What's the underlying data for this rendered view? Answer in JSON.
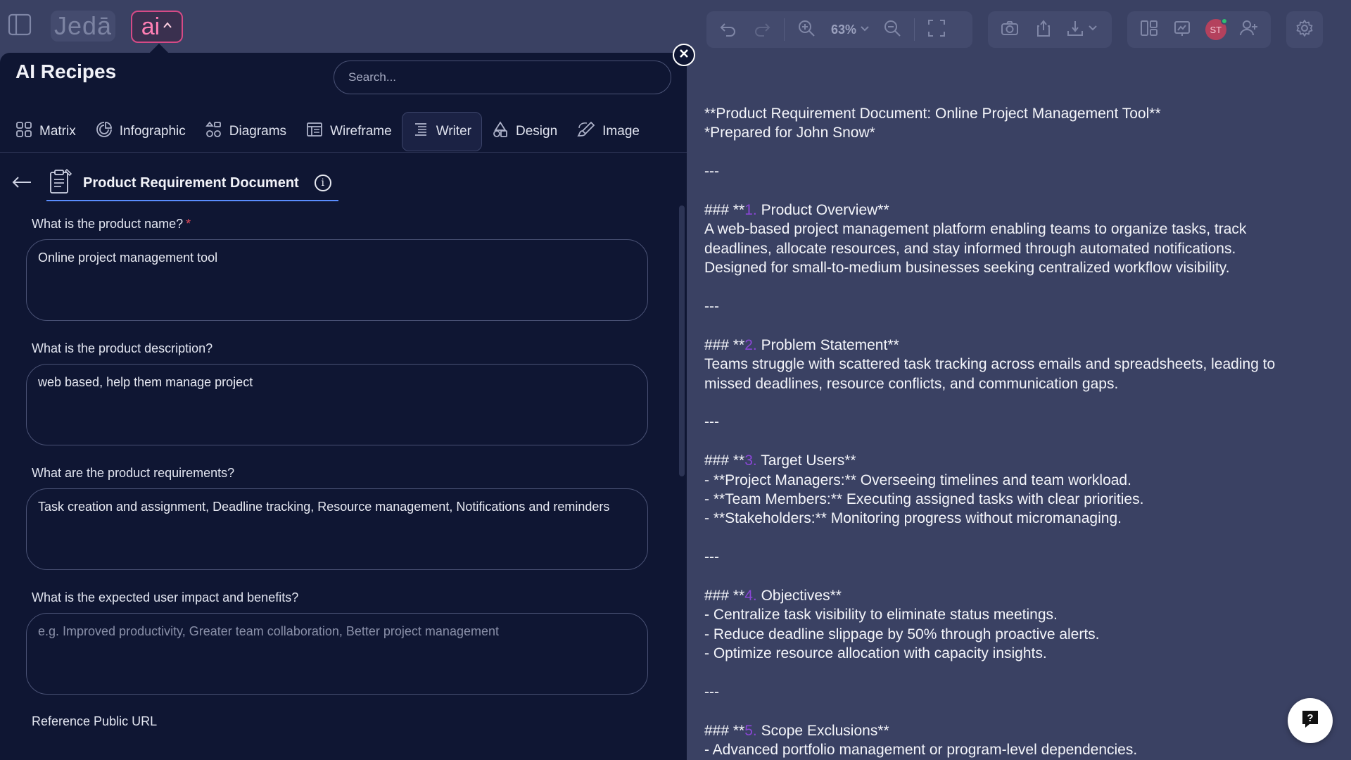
{
  "app": {
    "logo": "Jedā",
    "ai_badge": "ai"
  },
  "toolbar": {
    "zoom": "63%",
    "user_initials": "ST"
  },
  "panel": {
    "title": "AI Recipes",
    "search_placeholder": "Search...",
    "tabs": [
      {
        "label": "Matrix",
        "icon": "grid-icon"
      },
      {
        "label": "Infographic",
        "icon": "chart-icon"
      },
      {
        "label": "Diagrams",
        "icon": "diagram-icon"
      },
      {
        "label": "Wireframe",
        "icon": "wireframe-icon"
      },
      {
        "label": "Writer",
        "icon": "text-icon",
        "active": true
      },
      {
        "label": "Design",
        "icon": "shapes-icon"
      },
      {
        "label": "Image",
        "icon": "brush-icon"
      }
    ],
    "recipe_title": "Product Requirement Document",
    "fields": [
      {
        "label": "What is the product name?",
        "required": true,
        "value": "Online project management tool",
        "placeholder": ""
      },
      {
        "label": "What is the product description?",
        "required": false,
        "value": "web based, help them manage project",
        "placeholder": ""
      },
      {
        "label": "What are the product requirements?",
        "required": false,
        "value": "Task creation and assignment, Deadline tracking, Resource management, Notifications and reminders",
        "placeholder": ""
      },
      {
        "label": "What is the expected user impact and benefits?",
        "required": false,
        "value": "",
        "placeholder": "e.g. Improved productivity, Greater team collaboration, Better project management"
      },
      {
        "label": "Reference Public URL",
        "required": false,
        "value": "",
        "placeholder": ""
      }
    ]
  },
  "document": {
    "title_line": "**Product Requirement Document: Online Project Management Tool**",
    "subtitle_line": "*Prepared for John Snow*",
    "hr": "---",
    "heading_prefix": "### **",
    "sections": [
      {
        "num": "1.",
        "title": " Product Overview**",
        "body": [
          "A web-based project management platform enabling teams to organize tasks, track",
          "deadlines, allocate resources, and stay informed through automated notifications.",
          "Designed for small-to-medium businesses seeking centralized workflow visibility."
        ]
      },
      {
        "num": "2.",
        "title": " Problem Statement**",
        "body": [
          "Teams struggle with scattered task tracking across emails and spreadsheets, leading to",
          "missed deadlines, resource conflicts, and communication gaps."
        ]
      },
      {
        "num": "3.",
        "title": " Target Users**",
        "body": [
          "- **Project Managers:** Overseeing timelines and team workload.",
          "- **Team Members:** Executing assigned tasks with clear priorities.",
          "- **Stakeholders:** Monitoring progress without micromanaging."
        ]
      },
      {
        "num": "4.",
        "title": " Objectives**",
        "body": [
          "- Centralize task visibility to eliminate status meetings.",
          "- Reduce deadline slippage by 50% through proactive alerts.",
          "- Optimize resource allocation with capacity insights."
        ]
      },
      {
        "num": "5.",
        "title": " Scope Exclusions**",
        "body": [
          "- Advanced portfolio management or program-level dependencies."
        ]
      }
    ]
  },
  "colors": {
    "background": "#3a4163",
    "panel": "#0f1633",
    "accent_pink": "#d64a86",
    "section_number": "#8a46d6"
  }
}
